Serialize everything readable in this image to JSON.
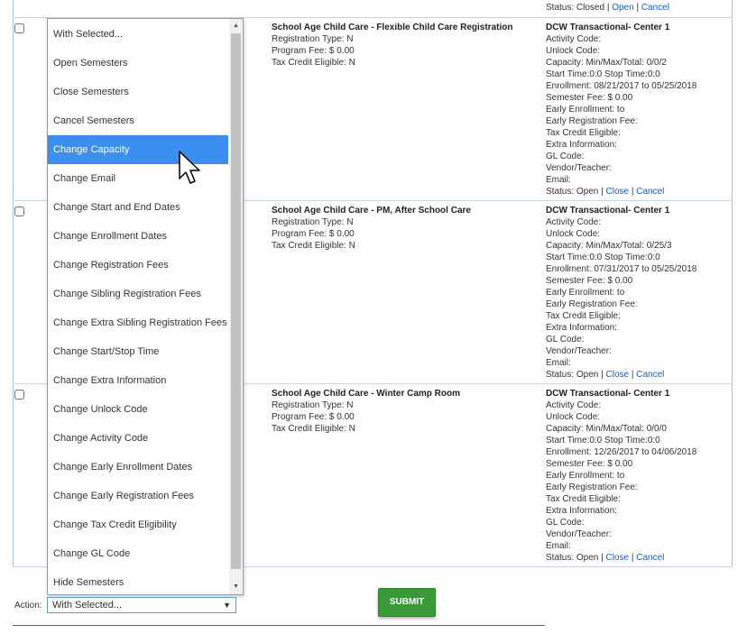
{
  "top_status": {
    "prefix": "Status: Closed | ",
    "open": "Open",
    "sep": " | ",
    "cancel": "Cancel"
  },
  "rows": [
    {
      "program_title": "School Age Child Care - Flexible Child Care Registration",
      "registration_type": "Registration Type: N",
      "program_fee": "Program Fee: $ 0.00",
      "tax_credit": "Tax Credit Eligible: N",
      "center": "DCW Transactional- Center 1",
      "activity_code": "Activity Code:",
      "unlock_code": "Unlock Code:",
      "capacity": "Capacity: Min/Max/Total: 0/0/2",
      "start_stop": "Start Time:0:0 Stop Time:0:0",
      "enrollment": "Enrollment: 08/21/2017 to 05/25/2018",
      "semester_fee": "Semester Fee: $ 0.00",
      "early_enrollment": "Early Enrollment: to",
      "early_registration_fee": "Early Registration Fee:",
      "tax_credit_eligible": "Tax Credit Eligible:",
      "extra_info": "Extra Information:",
      "gl_code": "GL Code:",
      "vendor": "Vendor/Teacher:",
      "email": "Email:",
      "status_prefix": "Status: Open | ",
      "close_link": "Close",
      "sep": " | ",
      "cancel_link": "Cancel"
    },
    {
      "program_title": "School Age Child Care - PM, After School Care",
      "registration_type": "Registration Type: N",
      "program_fee": "Program Fee: $ 0.00",
      "tax_credit": "Tax Credit Eligible: N",
      "center": "DCW Transactional- Center 1",
      "activity_code": "Activity Code:",
      "unlock_code": "Unlock Code:",
      "capacity": "Capacity: Min/Max/Total: 0/25/3",
      "start_stop": "Start Time:0:0 Stop Time:0:0",
      "enrollment": "Enrollment: 07/31/2017 to 05/25/2018",
      "semester_fee": "Semester Fee: $ 0.00",
      "early_enrollment": "Early Enrollment: to",
      "early_registration_fee": "Early Registration Fee:",
      "tax_credit_eligible": "Tax Credit Eligible:",
      "extra_info": "Extra Information:",
      "gl_code": "GL Code:",
      "vendor": "Vendor/Teacher:",
      "email": "Email:",
      "status_prefix": "Status: Open | ",
      "close_link": "Close",
      "sep": " | ",
      "cancel_link": "Cancel"
    },
    {
      "program_title": "School Age Child Care - Winter Camp Room",
      "registration_type": "Registration Type: N",
      "program_fee": "Program Fee: $ 0.00",
      "tax_credit": "Tax Credit Eligible: N",
      "center": "DCW Transactional- Center 1",
      "activity_code": "Activity Code:",
      "unlock_code": "Unlock Code:",
      "capacity": "Capacity: Min/Max/Total: 0/0/0",
      "start_stop": "Start Time:0:0 Stop Time:0:0",
      "enrollment": "Enrollment: 12/26/2017 to 04/06/2018",
      "semester_fee": "Semester Fee: $ 0.00",
      "early_enrollment": "Early Enrollment: to",
      "early_registration_fee": "Early Registration Fee:",
      "tax_credit_eligible": "Tax Credit Eligible:",
      "extra_info": "Extra Information:",
      "gl_code": "GL Code:",
      "vendor": "Vendor/Teacher:",
      "email": "Email:",
      "status_prefix": "Status: Open | ",
      "close_link": "Close",
      "sep": " | ",
      "cancel_link": "Cancel"
    }
  ],
  "dropdown": {
    "options": [
      "With Selected...",
      "Open Semesters",
      "Close Semesters",
      "Cancel Semesters",
      "Change Capacity",
      "Change Email",
      "Change Start and End Dates",
      "Change Enrollment Dates",
      "Change Registration Fees",
      "Change Sibling Registration Fees",
      "Change Extra Sibling Registration Fees",
      "Change Start/Stop Time",
      "Change Extra Information",
      "Change Unlock Code",
      "Change Activity Code",
      "Change Early Enrollment Dates",
      "Change Early Registration Fees",
      "Change Tax Credit Eligibility",
      "Change GL Code",
      "Hide Semesters"
    ],
    "highlighted": "Change Capacity"
  },
  "action": {
    "label": "Action:",
    "selected": "With Selected...",
    "arrow_icon": "triangle-down-icon"
  },
  "submit_label": "SUBMIT",
  "colors": {
    "highlight": "#3c8ff0",
    "submit": "#3a9a3a",
    "link": "#1a5db8"
  }
}
